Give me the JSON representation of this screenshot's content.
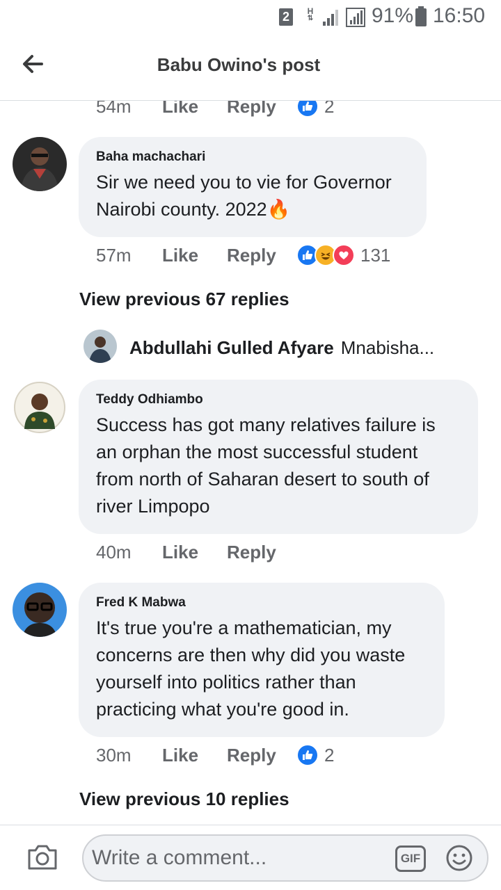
{
  "status_bar": {
    "sim_slot": "2",
    "network_type": "H",
    "battery_percent": "91%",
    "time": "16:50"
  },
  "header": {
    "title": "Babu Owino's post",
    "back_icon": "arrow-left-icon"
  },
  "top_meta": {
    "time": "54m",
    "like_label": "Like",
    "reply_label": "Reply",
    "reaction_count": "2"
  },
  "comments": [
    {
      "author": "Baha machachari",
      "text": "Sir we need you to vie for Governor Nairobi county. 2022",
      "emoji": "🔥",
      "time": "57m",
      "like_label": "Like",
      "reply_label": "Reply",
      "reactions": [
        "like",
        "haha",
        "love"
      ],
      "reaction_count": "131",
      "view_previous": "View previous 67 replies",
      "latest_reply": {
        "author": "Abdullahi Gulled Afyare",
        "text": "Mnabisha..."
      }
    },
    {
      "author": "Teddy Odhiambo",
      "text": "Success has got many relatives failure is an orphan the most successful student from north of Saharan desert to south of river Limpopo",
      "time": "40m",
      "like_label": "Like",
      "reply_label": "Reply"
    },
    {
      "author": "Fred K Mabwa",
      "text": "It's true you're a mathematician, my concerns are then why did you waste yourself into politics rather than practicing what you're good in.",
      "time": "30m",
      "like_label": "Like",
      "reply_label": "Reply",
      "reactions": [
        "like"
      ],
      "reaction_count": "2",
      "view_previous": "View previous 10 replies"
    }
  ],
  "composer": {
    "placeholder": "Write a comment...",
    "gif_label": "GIF",
    "camera_icon": "camera-icon",
    "emoji_icon": "emoji-icon"
  },
  "colors": {
    "like_blue": "#1877f2",
    "bubble_bg": "#f0f2f5",
    "meta_gray": "#65676b"
  }
}
